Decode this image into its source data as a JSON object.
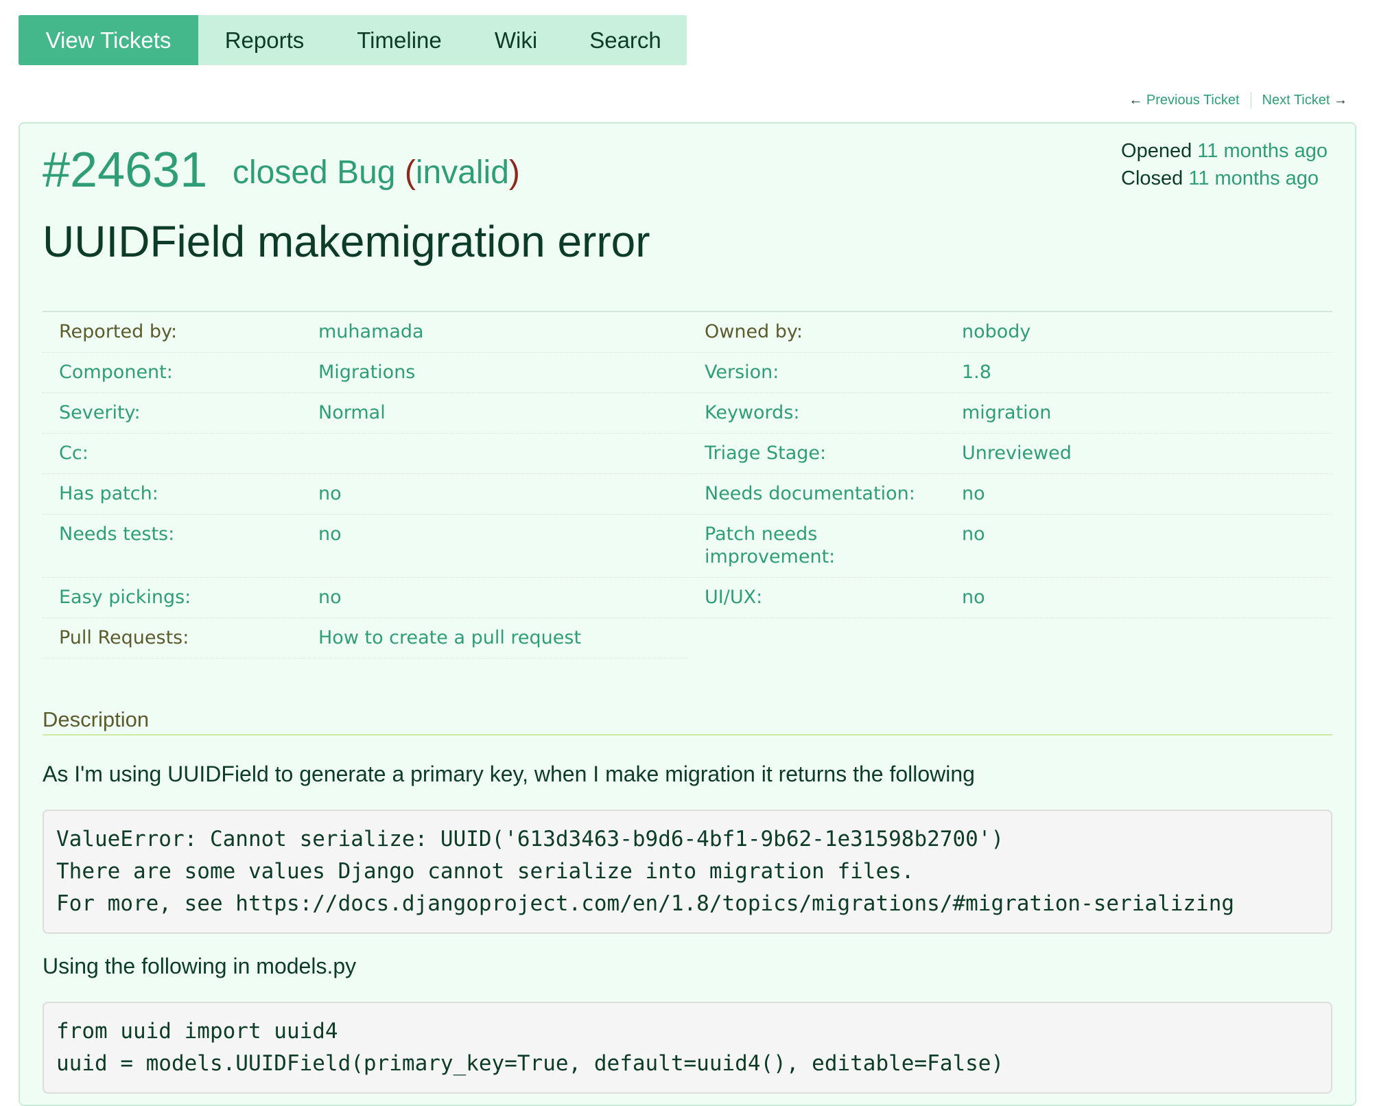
{
  "nav": {
    "items": [
      "View Tickets",
      "Reports",
      "Timeline",
      "Wiki",
      "Search"
    ]
  },
  "ticketnav": {
    "prev_arrow": "←",
    "prev_label": "Previous Ticket",
    "next_label": "Next Ticket",
    "next_arrow": "→"
  },
  "ticket": {
    "id": "#24631",
    "status": "closed",
    "type": "Bug",
    "resolution": "invalid",
    "summary": "UUIDField makemigration error",
    "opened_label": "Opened",
    "opened_value": "11 months ago",
    "closed_label": "Closed",
    "closed_value": "11 months ago"
  },
  "props": {
    "reported_by": {
      "label": "Reported by:",
      "value": "muhamada"
    },
    "owned_by": {
      "label": "Owned by:",
      "value": "nobody"
    },
    "component": {
      "label": "Component:",
      "value": "Migrations"
    },
    "version": {
      "label": "Version:",
      "value": "1.8"
    },
    "severity": {
      "label": "Severity:",
      "value": "Normal"
    },
    "keywords": {
      "label": "Keywords:",
      "value": "migration"
    },
    "cc": {
      "label": "Cc:",
      "value": ""
    },
    "triage_stage": {
      "label": "Triage Stage:",
      "value": "Unreviewed"
    },
    "has_patch": {
      "label": "Has patch:",
      "value": "no"
    },
    "needs_documentation": {
      "label": "Needs documentation:",
      "value": "no"
    },
    "needs_tests": {
      "label": "Needs tests:",
      "value": "no"
    },
    "patch_needs_improvement": {
      "label": "Patch needs improvement:",
      "value": "no"
    },
    "easy_pickings": {
      "label": "Easy pickings:",
      "value": "no"
    },
    "ui_ux": {
      "label": "UI/UX:",
      "value": "no"
    },
    "pull_requests": {
      "label": "Pull Requests:",
      "value": "How to create a pull request"
    }
  },
  "description": {
    "heading": "Description",
    "para1": "As I'm using UUIDField to generate a primary key, when I make migration it returns the following",
    "code1": "ValueError: Cannot serialize: UUID('613d3463-b9d6-4bf1-9b62-1e31598b2700')\nThere are some values Django cannot serialize into migration files.\nFor more, see https://docs.djangoproject.com/en/1.8/topics/migrations/#migration-serializing",
    "para2": "Using the following in models.py",
    "code2": "from uuid import uuid4\nuuid = models.UUIDField(primary_key=True, default=uuid4(), editable=False)"
  }
}
